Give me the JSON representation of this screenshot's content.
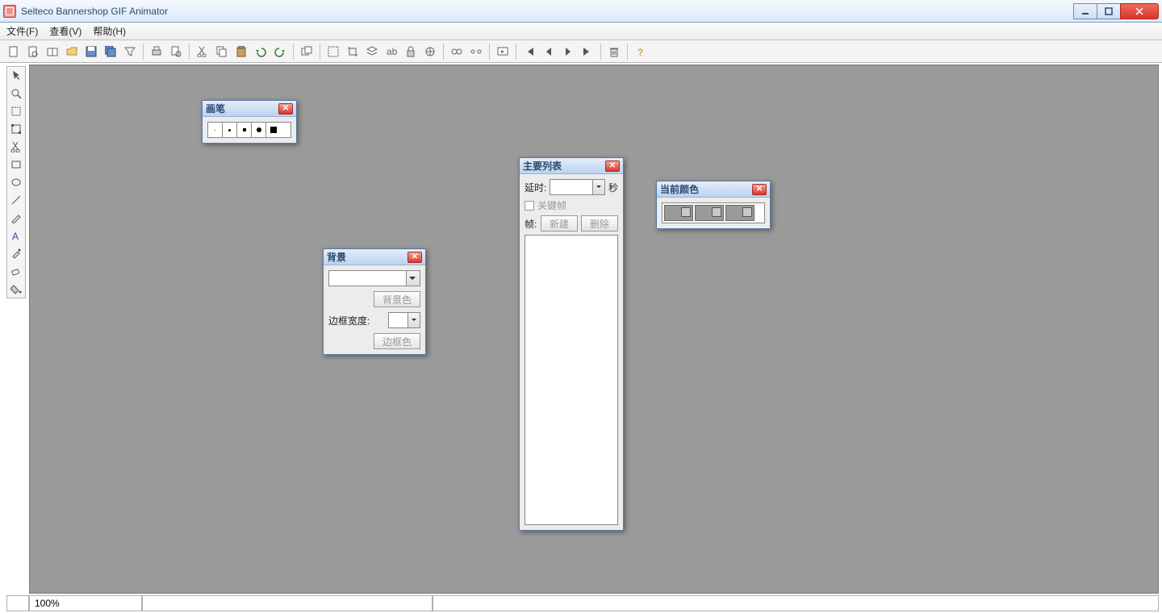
{
  "app": {
    "title": "Selteco Bannershop GIF Animator"
  },
  "menu": {
    "file": "文件(F)",
    "view": "查看(V)",
    "help": "帮助(H)"
  },
  "status": {
    "zoom": "100%"
  },
  "panels": {
    "brush": {
      "title": "画笔"
    },
    "background": {
      "title": "背景",
      "bgcolor_btn": "背景色",
      "borderwidth_label": "边框宽度:",
      "bordercolor_btn": "边框色"
    },
    "framelist": {
      "title": "主要列表",
      "delay_label": "延时:",
      "seconds": "秒",
      "keyframe": "关键帧",
      "frame_label": "帧:",
      "new_btn": "新建",
      "delete_btn": "删除"
    },
    "color": {
      "title": "当前颜色"
    }
  }
}
